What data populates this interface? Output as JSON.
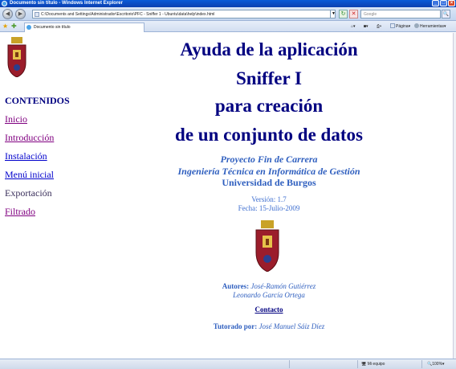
{
  "window": {
    "title": "Documento sin título - Windows Internet Explorer"
  },
  "address_bar": {
    "url": "C:\\Documents and Settings\\Administrador\\Escritorio\\PFC - Sniffer 1 - Ubuntu\\data\\help\\index.html",
    "search_placeholder": "Google"
  },
  "tab": {
    "label": "Documento sin título"
  },
  "commands": {
    "page": "Página",
    "tools": "Herramientas"
  },
  "sidebar": {
    "heading": "CONTENIDOS",
    "items": [
      {
        "label": "Inicio",
        "state": "visited"
      },
      {
        "label": "Introducción",
        "state": "visited"
      },
      {
        "label": "Instalación",
        "state": "link"
      },
      {
        "label": "Menú inicial",
        "state": "link"
      },
      {
        "label": "Exportación",
        "state": "plain"
      },
      {
        "label": "Filtrado",
        "state": "visited"
      }
    ]
  },
  "main": {
    "title_lines": [
      "Ayuda de la aplicación",
      "Sniffer I",
      "para creación",
      "de un conjunto de datos"
    ],
    "project": "Proyecto Fin de Carrera",
    "degree": "Ingeniería Técnica en Informática de Gestión",
    "university": "Universidad de Burgos",
    "version": "Versión: 1.7",
    "date": "Fecha: 15-Julio-2009",
    "authors_label": "Autores:",
    "author1": "José-Ramón Gutiérrez",
    "author2": "Leonardo García Ortega",
    "contact": "Contacto",
    "tutor_label": "Tutorado por:",
    "tutor": "José Manuel Sáiz Díez"
  },
  "status_bar": {
    "zone": "Mi equipo",
    "zoom": "100%"
  }
}
